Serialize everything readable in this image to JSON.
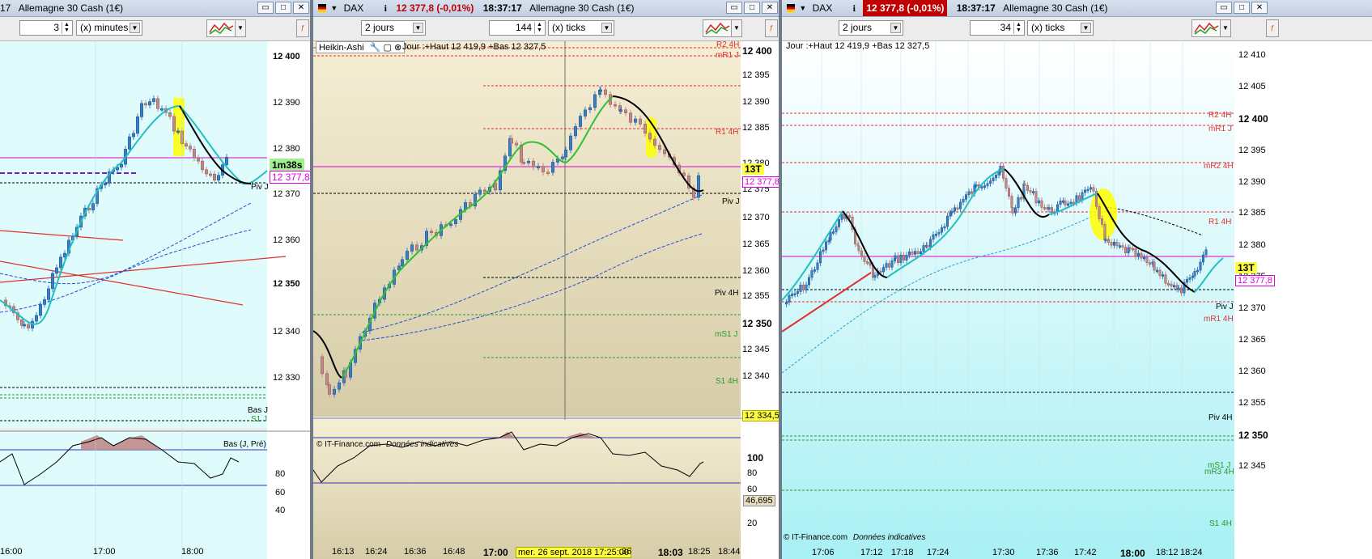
{
  "windows": [
    {
      "id": "left",
      "title": {
        "prefix": "17",
        "instrument": "Allemagne 30 Cash (1€)"
      },
      "toolbar": {
        "period_value": "3",
        "period_unit": "(x) minutes"
      },
      "yaxis": [
        "12 400",
        "12 390",
        "12 380",
        "12 370",
        "12 360",
        "12 350",
        "12 340",
        "12 330"
      ],
      "timer_label": "1m38s",
      "price_label": "12 377,8",
      "line_labels": [
        "Piv J",
        "Bas J",
        "S1 J",
        "Bas (J, Pré)"
      ],
      "osc_axis": [
        "80",
        "60",
        "40"
      ],
      "xaxis": [
        "16:00",
        "17:00",
        "18:00"
      ]
    },
    {
      "id": "middle",
      "title": {
        "symbol": "DAX",
        "price": "12 377,8 (-0,01%)",
        "time": "18:37:17",
        "instrument": "Allemagne 30 Cash (1€)"
      },
      "toolbar": {
        "range": "2 jours",
        "ticks_value": "144",
        "ticks_unit": "(x) ticks"
      },
      "panel_label": "Heikin-Ashi",
      "legend": "Jour :+Haut 12 419,9 +Bas 12 327,5",
      "yaxis": [
        "12 400",
        "12 395",
        "12 390",
        "12 385",
        "12 380",
        "12 375",
        "12 370",
        "12 365",
        "12 360",
        "12 355",
        "12 350",
        "12 345",
        "12 340",
        "12 335"
      ],
      "line_labels": [
        "R2 4H",
        "mR1 J",
        "R1 4H",
        "Piv J",
        "Piv 4H",
        "mS1 J",
        "S1 4H"
      ],
      "tick_label": "13T",
      "price_label": "12 377,8",
      "low_label": "12 334,5",
      "copyright": "© IT-Finance.com",
      "copyright_note": "Données indicatives",
      "osc_axis": [
        "100",
        "80",
        "60",
        "40",
        "20"
      ],
      "osc_value": "46,695",
      "xaxis": [
        "16:13",
        "16:24",
        "16:36",
        "16:48",
        "17:00",
        ":36",
        "18:03",
        "18:25",
        "18:44"
      ],
      "cursor_time": "mer. 26 sept. 2018 17:25:00"
    },
    {
      "id": "right",
      "title": {
        "symbol": "DAX",
        "price": "12 377,8 (-0,01%)",
        "time": "18:37:17",
        "instrument": "Allemagne 30 Cash (1€)"
      },
      "toolbar": {
        "range": "2 jours",
        "ticks_value": "34",
        "ticks_unit": "(x) ticks"
      },
      "legend": "Jour :+Haut 12 419,9 +Bas 12 327,5",
      "yaxis": [
        "12 410",
        "12 405",
        "12 400",
        "12 395",
        "12 390",
        "12 385",
        "12 380",
        "12 375",
        "12 370",
        "12 365",
        "12 360",
        "12 355",
        "12 350",
        "12 345"
      ],
      "line_labels": [
        "R2 4H",
        "mR1 J",
        "mR2 4H",
        "R1 4H",
        "Piv J",
        "mR1 4H",
        "Piv 4H",
        "mS1 J",
        "mR3 4H",
        "S1 4H"
      ],
      "tick_label": "13T",
      "price_label": "12 377,8",
      "copyright": "© IT-Finance.com",
      "copyright_note": "Données indicatives",
      "xaxis": [
        "17:06",
        "17:12",
        "17:18",
        "17:24",
        "17:30",
        "17:36",
        "17:42",
        "18:00",
        "18:12",
        "18:24"
      ]
    }
  ],
  "colors": {
    "up_candle": "#3d7fc4",
    "down_candle": "#c08a8a",
    "resistance": "#e03030",
    "support": "#2a9a2a",
    "pivot": "#000000",
    "price_line": "#e000e0",
    "highlight": "#ffff00",
    "ma_cyan": "#20c0c0",
    "ma_green": "#30c030"
  },
  "icons": [
    "dax-flag-icon",
    "info-icon",
    "window-minimize-icon",
    "window-maximize-icon",
    "window-close-icon",
    "wrench-icon",
    "square-icon",
    "close-circle-icon",
    "indicator-toolbar-icon"
  ]
}
